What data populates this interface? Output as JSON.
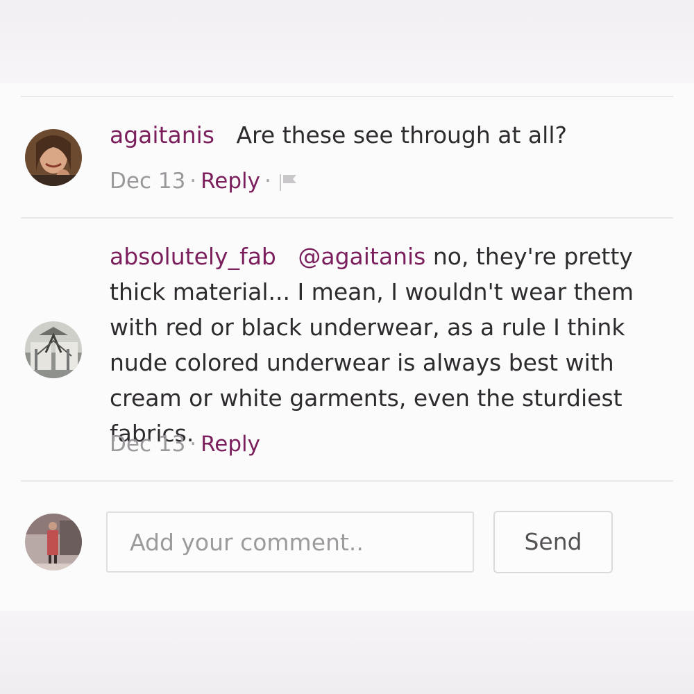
{
  "comments": [
    {
      "username": "agaitanis",
      "text": "Are these see through at all?",
      "date": "Dec 13",
      "reply_label": "Reply",
      "has_flag": true
    },
    {
      "username": "absolutely_fab",
      "mention": "@agaitanis",
      "text": " no, they're pretty thick material... I mean, I wouldn't wear them with red or black underwear, as a rule I think nude colored underwear is always best with cream or white garments, even the sturdiest fabrics.",
      "date": "Dec 13",
      "reply_label": "Reply"
    }
  ],
  "composer": {
    "placeholder": "Add your comment..",
    "send_label": "Send"
  },
  "colors": {
    "accent": "#7b1f5c",
    "meta_text": "#9a989a",
    "body_text": "#2e2b2e"
  },
  "icons": [
    "flag-icon"
  ]
}
